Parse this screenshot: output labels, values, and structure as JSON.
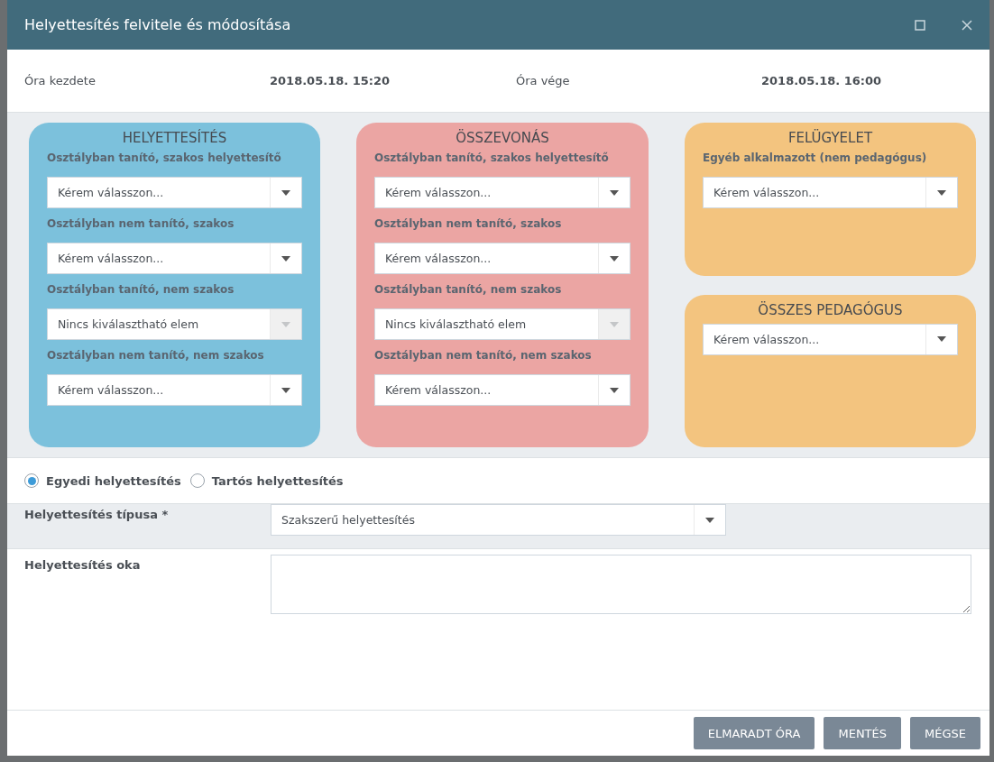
{
  "window": {
    "title": "Helyettesítés felvitele és módosítása"
  },
  "times": [
    {
      "label": "Óra kezdete",
      "value": "2018.05.18. 15:20"
    },
    {
      "label": "Óra vége",
      "value": "2018.05.18. 16:00"
    }
  ],
  "columns": [
    [
      {
        "title": "HELYETTESÍTÉS",
        "color": "#7cc1dc",
        "fields": [
          {
            "label": "Osztályban tanító, szakos helyettesítő",
            "placeholder": "Kérem válasszon...",
            "disabled": false
          },
          {
            "label": "Osztályban nem tanító, szakos",
            "placeholder": "Kérem válasszon...",
            "disabled": false
          },
          {
            "label": "Osztályban tanító, nem szakos",
            "placeholder": "Nincs kiválasztható elem",
            "disabled": true
          },
          {
            "label": "Osztályban nem tanító, nem szakos",
            "placeholder": "Kérem válasszon...",
            "disabled": false
          }
        ]
      }
    ],
    [
      {
        "title": "ÖSSZEVONÁS",
        "color": "#eba5a3",
        "fields": [
          {
            "label": "Osztályban tanító, szakos helyettesítő",
            "placeholder": "Kérem válasszon...",
            "disabled": false
          },
          {
            "label": "Osztályban nem tanító, szakos",
            "placeholder": "Kérem válasszon...",
            "disabled": false
          },
          {
            "label": "Osztályban tanító, nem szakos",
            "placeholder": "Nincs kiválasztható elem",
            "disabled": true
          },
          {
            "label": "Osztályban nem tanító, nem szakos",
            "placeholder": "Kérem válasszon...",
            "disabled": false
          }
        ]
      }
    ],
    [
      {
        "title": "FELÜGYELET",
        "color": "#f3c47f",
        "fields": [
          {
            "label": "Egyéb alkalmazott (nem pedagógus)",
            "placeholder": "Kérem válasszon...",
            "disabled": false
          }
        ]
      },
      {
        "title": "ÖSSZES PEDAGÓGUS",
        "color": "#f3c47f",
        "fields": [
          {
            "placeholder": "Kérem válasszon...",
            "disabled": false
          }
        ]
      }
    ]
  ],
  "radios": [
    {
      "label": "Egyedi helyettesítés",
      "selected": true
    },
    {
      "label": "Tartós helyettesítés",
      "selected": false
    }
  ],
  "type_field": {
    "label": "Helyettesítés típusa *",
    "value": "Szakszerű helyettesítés"
  },
  "reason_field": {
    "label": "Helyettesítés oka"
  },
  "buttons": [
    "ELMARADT ÓRA",
    "MENTÉS",
    "MÉGSE"
  ]
}
